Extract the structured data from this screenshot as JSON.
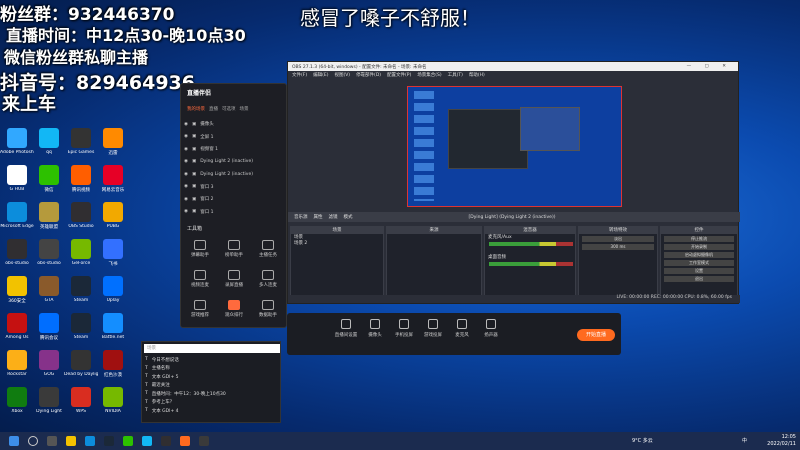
{
  "overlay": {
    "fans": "粉丝群：932446370",
    "live_time": "直播时间：中12点30-晚10点30",
    "wechat": "微信粉丝群私聊主播",
    "douyin": "抖音号：829464936",
    "ride": "来上车",
    "center": "感冒了嗓子不舒服！"
  },
  "desktop_icons": [
    {
      "label": "Adobe Photoshop",
      "color": "#31a8ff"
    },
    {
      "label": "qq",
      "color": "#12b7f5"
    },
    {
      "label": "Epic Games",
      "color": "#333333"
    },
    {
      "label": "迅雷",
      "color": "#ff8a00"
    },
    {
      "label": "G HUB",
      "color": "#ffffff"
    },
    {
      "label": "微信",
      "color": "#2dc100"
    },
    {
      "label": "腾讯视频",
      "color": "#ff5e00"
    },
    {
      "label": "网易云音乐",
      "color": "#e60026"
    },
    {
      "label": "Microsoft Edge",
      "color": "#0c8ddc"
    },
    {
      "label": "英雄联盟",
      "color": "#b59a3c"
    },
    {
      "label": "OBS Studio",
      "color": "#302e31"
    },
    {
      "label": "PUBG",
      "color": "#f2a900"
    },
    {
      "label": "obs-studio",
      "color": "#302e31"
    },
    {
      "label": "obs-studio",
      "color": "#444444"
    },
    {
      "label": "GeForce",
      "color": "#76b900"
    },
    {
      "label": "飞书",
      "color": "#3370ff"
    },
    {
      "label": "360安全",
      "color": "#f2c200"
    },
    {
      "label": "GTA",
      "color": "#8a5a2b"
    },
    {
      "label": "Steam",
      "color": "#1b2838"
    },
    {
      "label": "Uplay",
      "color": "#0070ff"
    },
    {
      "label": "Among Us",
      "color": "#c51111"
    },
    {
      "label": "腾讯会议",
      "color": "#006eff"
    },
    {
      "label": "Steam",
      "color": "#1b2838"
    },
    {
      "label": "Battle.net",
      "color": "#148eff"
    },
    {
      "label": "Rockstar",
      "color": "#fcaf17"
    },
    {
      "label": "GOG",
      "color": "#86328a"
    },
    {
      "label": "Dead by Daylight",
      "color": "#333333"
    },
    {
      "label": "红色沙漠",
      "color": "#a01010"
    },
    {
      "label": "Xbox",
      "color": "#107c10"
    },
    {
      "label": "Dying Light",
      "color": "#3a3a3a"
    },
    {
      "label": "WPS",
      "color": "#d92d20"
    },
    {
      "label": "NVIDIA",
      "color": "#76b900"
    }
  ],
  "assistant": {
    "logo": "直播伴侣",
    "tabs": [
      "我的场景",
      "直播",
      "可选项",
      "场景"
    ],
    "scenes": [
      "摄像头",
      "全屏 1",
      "视频窗 1",
      "Dying Light 2 (inactive)",
      "Dying Light 2 (inactive)",
      "窗口 3",
      "窗口 2",
      "窗口 1"
    ],
    "tools_title": "工具箱",
    "tools": [
      "弹幕助手",
      "榜单助手",
      "主播任务",
      "视频连麦",
      "录屏直播",
      "多人连麦",
      "游戏推荐",
      "观众排行",
      "数据助手"
    ]
  },
  "obs": {
    "title": "OBS 27.1.3 (64-bit, windows) - 配置文件: 未命名 - 场景: 未命名",
    "menu": [
      "文件(F)",
      "编辑(E)",
      "视图(V)",
      "停靠部件(D)",
      "配置文件(P)",
      "场景集合(S)",
      "工具(T)",
      "帮助(H)"
    ],
    "controls": [
      "音乐源",
      "属性",
      "滤镜",
      "模式",
      "[Dying Light] (Dying Light 2 (inactive))"
    ],
    "docks": {
      "scenes": "场景",
      "sources": "来源",
      "mixer": "混音器",
      "transitions": "转场特效",
      "controls": "控件"
    },
    "scene_items": [
      "场景",
      "场景 2"
    ],
    "mixer_items": [
      "麦克风/Aux",
      "桌面音频"
    ],
    "transition": "淡出",
    "duration": "300 ms",
    "control_buttons": [
      "停止推流",
      "开始录制",
      "启动虚拟摄像机",
      "工作室模式",
      "设置",
      "退出"
    ],
    "status": "LIVE: 00:00:00  REC: 00:00:00  CPU: 0.8%, 60.00 fps"
  },
  "bottom_toolbar": {
    "items": [
      "直播间设置",
      "摄像头",
      "手机投屏",
      "游戏投屏",
      "麦克风",
      "扬声器"
    ],
    "start": "开始直播"
  },
  "text_panel": {
    "placeholder": "场景",
    "rows": [
      "今日不想说话",
      "主播名称",
      "文本 GDI+ 5",
      "最近关注",
      "直播时间：中午12：30-晚上10点30",
      "参考上车？",
      "文本 GDI+ 4"
    ]
  },
  "taskbar": {
    "time": "12:05",
    "date": "2022/02/11",
    "weather": "9°C 多云",
    "lang": "中"
  }
}
